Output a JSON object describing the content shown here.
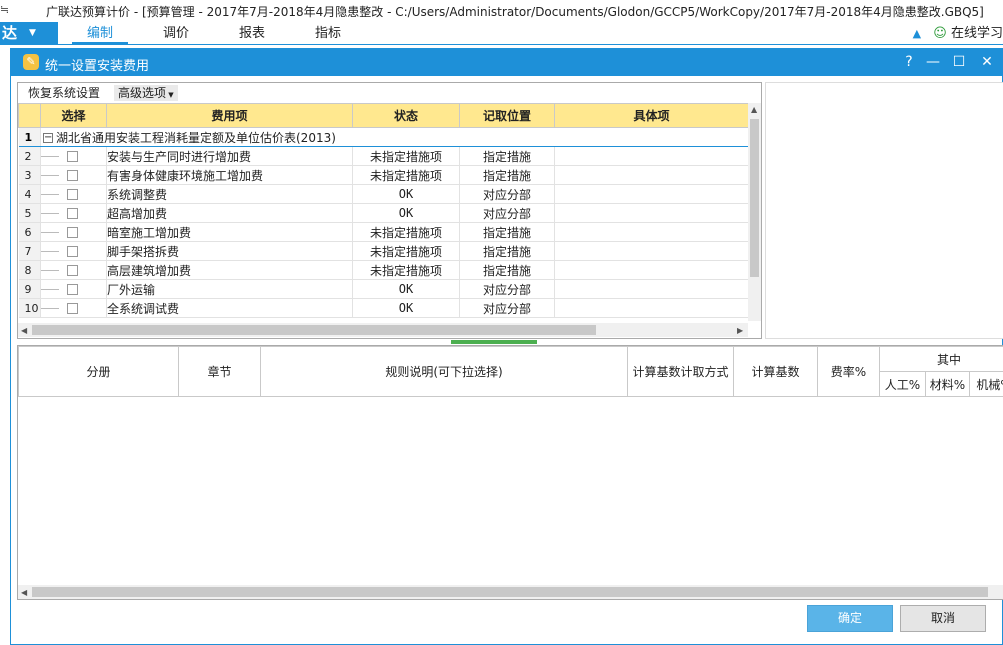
{
  "window": {
    "icon": "≒",
    "title": "广联达预算计价 - [预算管理 - 2017年7月-2018年4月隐患整改 - C:/Users/Administrator/Documents/Glodon/GCCP5/WorkCopy/2017年7月-2018年4月隐患整改.GBQ5]"
  },
  "menubar": {
    "app_label": "达",
    "tabs": [
      "编制",
      "调价",
      "报表",
      "指标"
    ],
    "online_learning": "在线学习"
  },
  "dialog": {
    "title": "统一设置安装费用",
    "controls": {
      "help": "?",
      "minimize": "—",
      "maximize": "☐",
      "close": "✕"
    },
    "toolbar": {
      "restore": "恢复系统设置",
      "advanced": "高级选项"
    },
    "columns": [
      "选择",
      "费用项",
      "状态",
      "记取位置",
      "具体项"
    ],
    "group": {
      "num": "1",
      "label": "湖北省通用安装工程消耗量定额及单位估价表(2013)"
    },
    "rows": [
      {
        "num": "2",
        "item": "安装与生产同时进行增加费",
        "status": "未指定措施项",
        "position": "指定措施"
      },
      {
        "num": "3",
        "item": "有害身体健康环境施工增加费",
        "status": "未指定措施项",
        "position": "指定措施"
      },
      {
        "num": "4",
        "item": "系统调整费",
        "status": "OK",
        "position": "对应分部"
      },
      {
        "num": "5",
        "item": "超高增加费",
        "status": "OK",
        "position": "对应分部"
      },
      {
        "num": "6",
        "item": "暗室施工增加费",
        "status": "未指定措施项",
        "position": "指定措施"
      },
      {
        "num": "7",
        "item": "脚手架搭拆费",
        "status": "未指定措施项",
        "position": "指定措施"
      },
      {
        "num": "8",
        "item": "高层建筑增加费",
        "status": "未指定措施项",
        "position": "指定措施"
      },
      {
        "num": "9",
        "item": "厂外运输",
        "status": "OK",
        "position": "对应分部"
      },
      {
        "num": "10",
        "item": "全系统调试费",
        "status": "OK",
        "position": "对应分部"
      }
    ],
    "lower_columns": {
      "division": "分册",
      "chapter": "章节",
      "rule": "规则说明(可下拉选择)",
      "calc_method": "计算基数计取方式",
      "base": "计算基数",
      "rate": "费率%",
      "including": "其中",
      "labor": "人工%",
      "material": "材料%",
      "machine": "机械%"
    },
    "buttons": {
      "ok": "确定",
      "cancel": "取消"
    }
  }
}
